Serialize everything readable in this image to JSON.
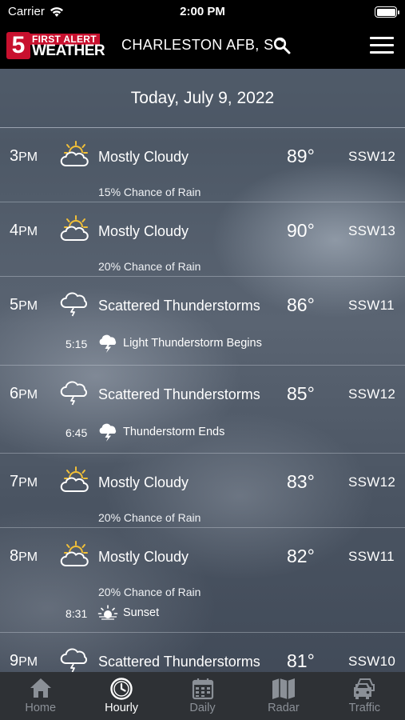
{
  "status_bar": {
    "carrier": "Carrier",
    "time": "2:00 PM"
  },
  "header": {
    "logo_number": "5",
    "logo_top": "FIRST ALERT",
    "logo_bottom": "WEATHER",
    "location": "CHARLESTON AFB, SC"
  },
  "date_label": "Today, July 9, 2022",
  "hours": [
    {
      "hour": "3",
      "ampm": "PM",
      "icon": "partly-cloudy-icon",
      "condition": "Mostly Cloudy",
      "temp": "89°",
      "wind": "SSW12",
      "rain": "15% Chance of Rain"
    },
    {
      "hour": "4",
      "ampm": "PM",
      "icon": "partly-cloudy-icon",
      "condition": "Mostly Cloudy",
      "temp": "90°",
      "wind": "SSW13",
      "rain": "20% Chance of Rain"
    },
    {
      "hour": "5",
      "ampm": "PM",
      "icon": "thunderstorm-cloud-icon",
      "condition": "Scattered Thunderstorms",
      "temp": "86°",
      "wind": "SSW11",
      "event": {
        "time": "5:15",
        "icon": "lightning-cloud-icon",
        "label": "Light Thunderstorm Begins"
      }
    },
    {
      "hour": "6",
      "ampm": "PM",
      "icon": "thunderstorm-cloud-icon",
      "condition": "Scattered Thunderstorms",
      "temp": "85°",
      "wind": "SSW12",
      "event": {
        "time": "6:45",
        "icon": "lightning-cloud-icon",
        "label": "Thunderstorm Ends"
      }
    },
    {
      "hour": "7",
      "ampm": "PM",
      "icon": "partly-cloudy-icon",
      "condition": "Mostly Cloudy",
      "temp": "83°",
      "wind": "SSW12",
      "rain": "20% Chance of Rain"
    },
    {
      "hour": "8",
      "ampm": "PM",
      "icon": "partly-cloudy-icon",
      "condition": "Mostly Cloudy",
      "temp": "82°",
      "wind": "SSW11",
      "rain": "20% Chance of Rain",
      "event": {
        "time": "8:31",
        "icon": "sunset-icon",
        "label": "Sunset"
      }
    },
    {
      "hour": "9",
      "ampm": "PM",
      "icon": "thunderstorm-cloud-icon",
      "condition": "Scattered Thunderstorms",
      "temp": "81°",
      "wind": "SSW10"
    }
  ],
  "tabs": [
    {
      "label": "Home",
      "icon": "home-icon",
      "active": false
    },
    {
      "label": "Hourly",
      "icon": "clock-icon",
      "active": true
    },
    {
      "label": "Daily",
      "icon": "calendar-icon",
      "active": false
    },
    {
      "label": "Radar",
      "icon": "map-icon",
      "active": false
    },
    {
      "label": "Traffic",
      "icon": "car-icon",
      "active": false
    }
  ],
  "colors": {
    "brand_red": "#c8102e",
    "tab_bar": "#2e3135",
    "tab_inactive": "#8b9097"
  }
}
